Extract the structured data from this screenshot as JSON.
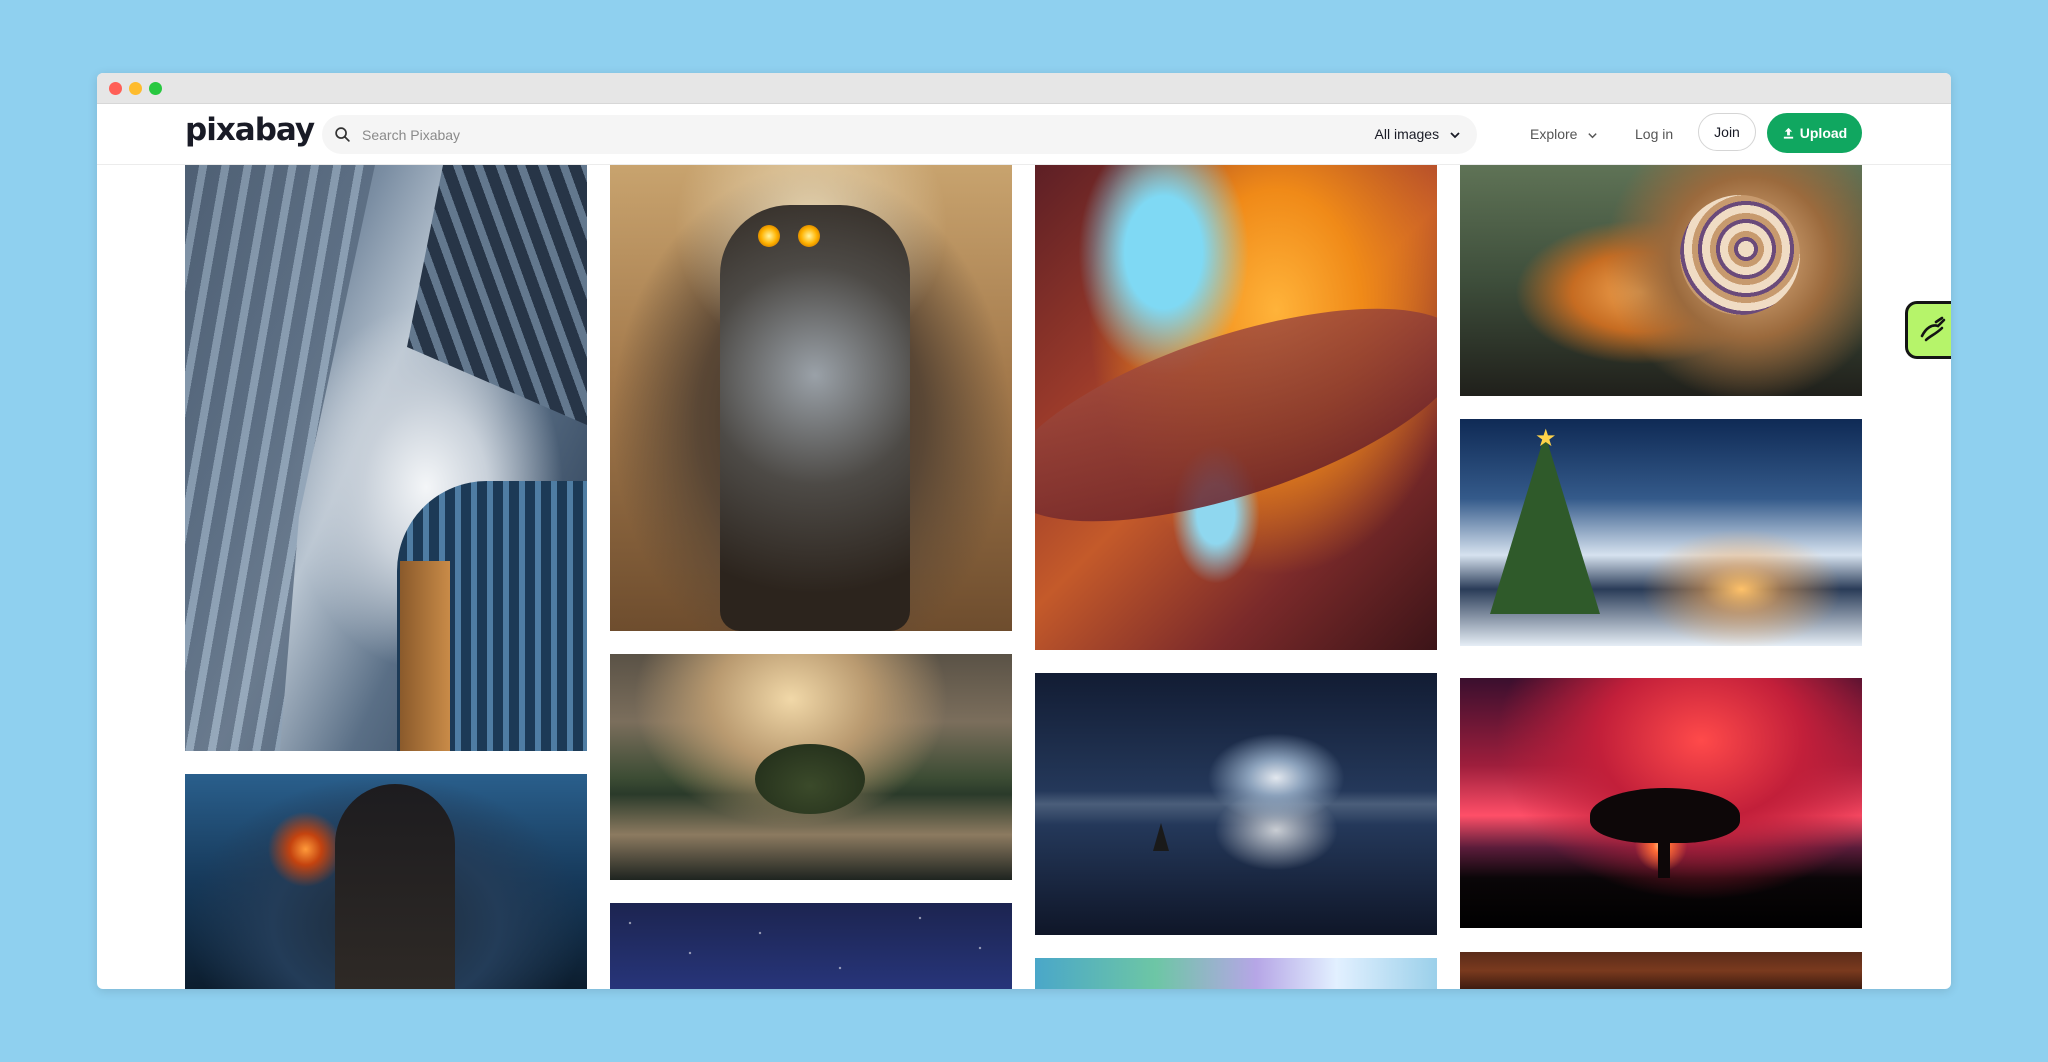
{
  "browser": {
    "controls": [
      "close",
      "minimize",
      "maximize"
    ]
  },
  "header": {
    "logo_text": "pixabay",
    "search": {
      "placeholder": "Search Pixabay",
      "icon": "search-icon",
      "filter_label": "All images"
    },
    "nav": {
      "explore_label": "Explore",
      "login_label": "Log in",
      "join_label": "Join",
      "upload_label": "Upload"
    },
    "colors": {
      "brand_green": "#10a760",
      "widget_green": "#b6f46a",
      "page_background": "#8fd0ef"
    }
  },
  "gallery": {
    "columns": 4,
    "images": [
      {
        "subject": "skyscrapers-looking-up",
        "column": 1
      },
      {
        "subject": "hooded-figure-with-lantern",
        "column": 1
      },
      {
        "subject": "robot-warrior",
        "column": 2
      },
      {
        "subject": "mountain-lake-lightning",
        "column": 2
      },
      {
        "subject": "starry-night-sky",
        "column": 2
      },
      {
        "subject": "canyon-rock-formation",
        "column": 3
      },
      {
        "subject": "sailboat-night-sea",
        "column": 3
      },
      {
        "subject": "colorful-bubbles",
        "column": 3
      },
      {
        "subject": "snail",
        "column": 4
      },
      {
        "subject": "christmas-village",
        "column": 4
      },
      {
        "subject": "red-sky-tree",
        "column": 4
      },
      {
        "subject": "warm-interior",
        "column": 4
      }
    ]
  },
  "side_widget": {
    "icon": "hand-stamp-icon"
  }
}
